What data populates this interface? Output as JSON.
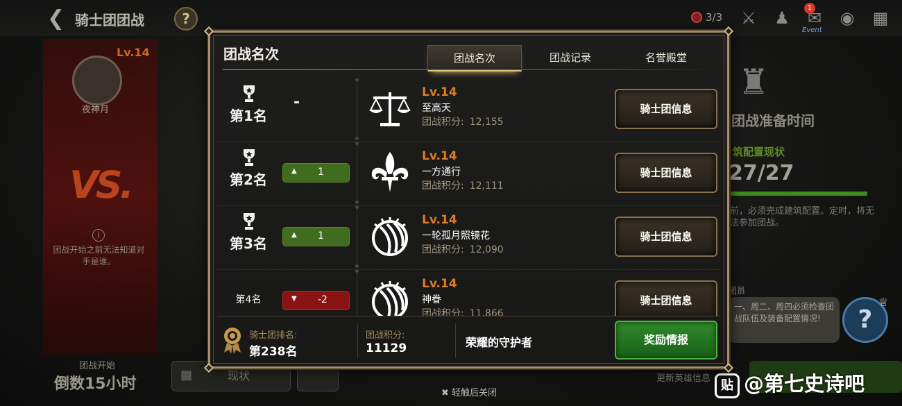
{
  "header": {
    "title": "骑士团团战",
    "help_icon": "question-icon",
    "ticket_count": "3/3",
    "event_badge": "1",
    "event_label": "Event"
  },
  "background": {
    "left": {
      "level": "Lv.14",
      "guild_name": "夜神月",
      "note": "团战开始之前无法知道对手是谁。",
      "countdown_caption": "团战开始",
      "countdown_value": "倒数15小时",
      "status_button": "现状"
    },
    "right": {
      "prep_title": "团战准备时间",
      "prep_sub": "筑配置现状",
      "prep_count": "27/27",
      "prep_progress": 1.0,
      "prep_note": "前，必须完成建筑配置。定时，将无法参加团战。",
      "member_tag": "团员",
      "member_note": "一、周二、周四必须检查团战队伍及装备配置情况!",
      "update_text": "更新英雄信息"
    },
    "close_hint": "轻触后关闭",
    "watermark": "@第七史诗吧"
  },
  "modal": {
    "title": "团战名次",
    "tabs": [
      {
        "label": "团战名次",
        "active": true
      },
      {
        "label": "团战记录",
        "active": false
      },
      {
        "label": "名誉殿堂",
        "active": false
      }
    ],
    "score_label": "团战积分:",
    "info_button_label": "骑士团信息",
    "rows": [
      {
        "rank": "第1名",
        "change": "-",
        "direction": "none",
        "level": "Lv.14",
        "guild": "至高天",
        "score": "12,155",
        "emblem": "scales-icon"
      },
      {
        "rank": "第2名",
        "change": "1",
        "direction": "up",
        "level": "Lv.14",
        "guild": "一方通行",
        "score": "12,111",
        "emblem": "fleur-de-lis-icon"
      },
      {
        "rank": "第3名",
        "change": "1",
        "direction": "up",
        "level": "Lv.14",
        "guild": "一轮孤月照镜花",
        "score": "12,090",
        "emblem": "claw-circle-icon"
      },
      {
        "rank": "第4名",
        "change": "-2",
        "direction": "down",
        "level": "Lv.14",
        "guild": "神眷",
        "score": "11,866",
        "emblem": "claw-circle-icon"
      }
    ],
    "footer": {
      "rank_label": "骑士团排名:",
      "rank_value": "第238名",
      "score_label": "团战积分:",
      "score_value": "11129",
      "honor_title": "荣耀的守护者",
      "reward_button": "奖励情报"
    }
  }
}
